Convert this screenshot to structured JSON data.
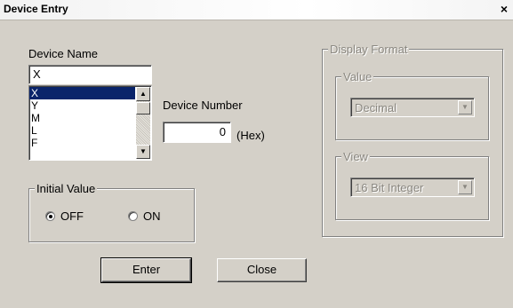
{
  "window": {
    "title": "Device Entry",
    "close_glyph": "×"
  },
  "device_name": {
    "label": "Device Name",
    "value": "X",
    "list": [
      {
        "text": "X",
        "selected": true
      },
      {
        "text": "Y",
        "selected": false
      },
      {
        "text": "M",
        "selected": false
      },
      {
        "text": "L",
        "selected": false
      },
      {
        "text": "F",
        "selected": false
      }
    ]
  },
  "device_number": {
    "label": "Device Number",
    "value": "0",
    "unit": "(Hex)"
  },
  "initial_value": {
    "title": "Initial Value",
    "options": [
      {
        "label": "OFF",
        "selected": true
      },
      {
        "label": "ON",
        "selected": false
      }
    ]
  },
  "display_format": {
    "title": "Display Format",
    "value_group": {
      "title": "Value",
      "selected": "Decimal"
    },
    "view_group": {
      "title": "View",
      "selected": "16 Bit Integer"
    }
  },
  "buttons": {
    "enter": "Enter",
    "close": "Close"
  },
  "icons": {
    "scroll_up": "scroll-up-icon",
    "scroll_down": "scroll-down-icon",
    "dropdown": "dropdown-arrow-icon"
  }
}
